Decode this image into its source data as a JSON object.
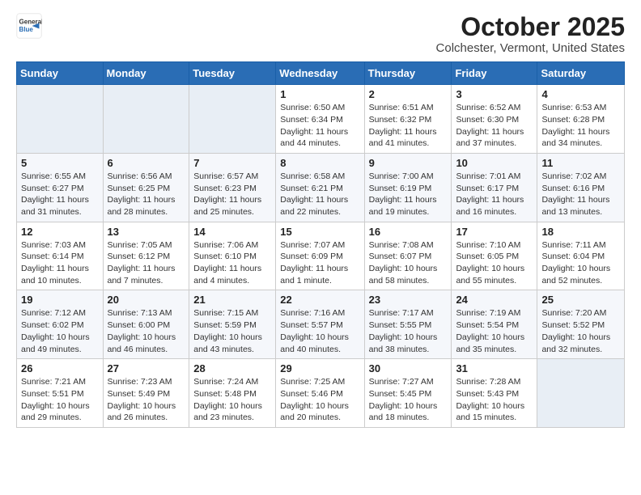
{
  "header": {
    "logo_general": "General",
    "logo_blue": "Blue",
    "month_title": "October 2025",
    "location": "Colchester, Vermont, United States"
  },
  "days_of_week": [
    "Sunday",
    "Monday",
    "Tuesday",
    "Wednesday",
    "Thursday",
    "Friday",
    "Saturday"
  ],
  "weeks": [
    [
      {
        "day": "",
        "info": ""
      },
      {
        "day": "",
        "info": ""
      },
      {
        "day": "",
        "info": ""
      },
      {
        "day": "1",
        "info": "Sunrise: 6:50 AM\nSunset: 6:34 PM\nDaylight: 11 hours and 44 minutes."
      },
      {
        "day": "2",
        "info": "Sunrise: 6:51 AM\nSunset: 6:32 PM\nDaylight: 11 hours and 41 minutes."
      },
      {
        "day": "3",
        "info": "Sunrise: 6:52 AM\nSunset: 6:30 PM\nDaylight: 11 hours and 37 minutes."
      },
      {
        "day": "4",
        "info": "Sunrise: 6:53 AM\nSunset: 6:28 PM\nDaylight: 11 hours and 34 minutes."
      }
    ],
    [
      {
        "day": "5",
        "info": "Sunrise: 6:55 AM\nSunset: 6:27 PM\nDaylight: 11 hours and 31 minutes."
      },
      {
        "day": "6",
        "info": "Sunrise: 6:56 AM\nSunset: 6:25 PM\nDaylight: 11 hours and 28 minutes."
      },
      {
        "day": "7",
        "info": "Sunrise: 6:57 AM\nSunset: 6:23 PM\nDaylight: 11 hours and 25 minutes."
      },
      {
        "day": "8",
        "info": "Sunrise: 6:58 AM\nSunset: 6:21 PM\nDaylight: 11 hours and 22 minutes."
      },
      {
        "day": "9",
        "info": "Sunrise: 7:00 AM\nSunset: 6:19 PM\nDaylight: 11 hours and 19 minutes."
      },
      {
        "day": "10",
        "info": "Sunrise: 7:01 AM\nSunset: 6:17 PM\nDaylight: 11 hours and 16 minutes."
      },
      {
        "day": "11",
        "info": "Sunrise: 7:02 AM\nSunset: 6:16 PM\nDaylight: 11 hours and 13 minutes."
      }
    ],
    [
      {
        "day": "12",
        "info": "Sunrise: 7:03 AM\nSunset: 6:14 PM\nDaylight: 11 hours and 10 minutes."
      },
      {
        "day": "13",
        "info": "Sunrise: 7:05 AM\nSunset: 6:12 PM\nDaylight: 11 hours and 7 minutes."
      },
      {
        "day": "14",
        "info": "Sunrise: 7:06 AM\nSunset: 6:10 PM\nDaylight: 11 hours and 4 minutes."
      },
      {
        "day": "15",
        "info": "Sunrise: 7:07 AM\nSunset: 6:09 PM\nDaylight: 11 hours and 1 minute."
      },
      {
        "day": "16",
        "info": "Sunrise: 7:08 AM\nSunset: 6:07 PM\nDaylight: 10 hours and 58 minutes."
      },
      {
        "day": "17",
        "info": "Sunrise: 7:10 AM\nSunset: 6:05 PM\nDaylight: 10 hours and 55 minutes."
      },
      {
        "day": "18",
        "info": "Sunrise: 7:11 AM\nSunset: 6:04 PM\nDaylight: 10 hours and 52 minutes."
      }
    ],
    [
      {
        "day": "19",
        "info": "Sunrise: 7:12 AM\nSunset: 6:02 PM\nDaylight: 10 hours and 49 minutes."
      },
      {
        "day": "20",
        "info": "Sunrise: 7:13 AM\nSunset: 6:00 PM\nDaylight: 10 hours and 46 minutes."
      },
      {
        "day": "21",
        "info": "Sunrise: 7:15 AM\nSunset: 5:59 PM\nDaylight: 10 hours and 43 minutes."
      },
      {
        "day": "22",
        "info": "Sunrise: 7:16 AM\nSunset: 5:57 PM\nDaylight: 10 hours and 40 minutes."
      },
      {
        "day": "23",
        "info": "Sunrise: 7:17 AM\nSunset: 5:55 PM\nDaylight: 10 hours and 38 minutes."
      },
      {
        "day": "24",
        "info": "Sunrise: 7:19 AM\nSunset: 5:54 PM\nDaylight: 10 hours and 35 minutes."
      },
      {
        "day": "25",
        "info": "Sunrise: 7:20 AM\nSunset: 5:52 PM\nDaylight: 10 hours and 32 minutes."
      }
    ],
    [
      {
        "day": "26",
        "info": "Sunrise: 7:21 AM\nSunset: 5:51 PM\nDaylight: 10 hours and 29 minutes."
      },
      {
        "day": "27",
        "info": "Sunrise: 7:23 AM\nSunset: 5:49 PM\nDaylight: 10 hours and 26 minutes."
      },
      {
        "day": "28",
        "info": "Sunrise: 7:24 AM\nSunset: 5:48 PM\nDaylight: 10 hours and 23 minutes."
      },
      {
        "day": "29",
        "info": "Sunrise: 7:25 AM\nSunset: 5:46 PM\nDaylight: 10 hours and 20 minutes."
      },
      {
        "day": "30",
        "info": "Sunrise: 7:27 AM\nSunset: 5:45 PM\nDaylight: 10 hours and 18 minutes."
      },
      {
        "day": "31",
        "info": "Sunrise: 7:28 AM\nSunset: 5:43 PM\nDaylight: 10 hours and 15 minutes."
      },
      {
        "day": "",
        "info": ""
      }
    ]
  ]
}
